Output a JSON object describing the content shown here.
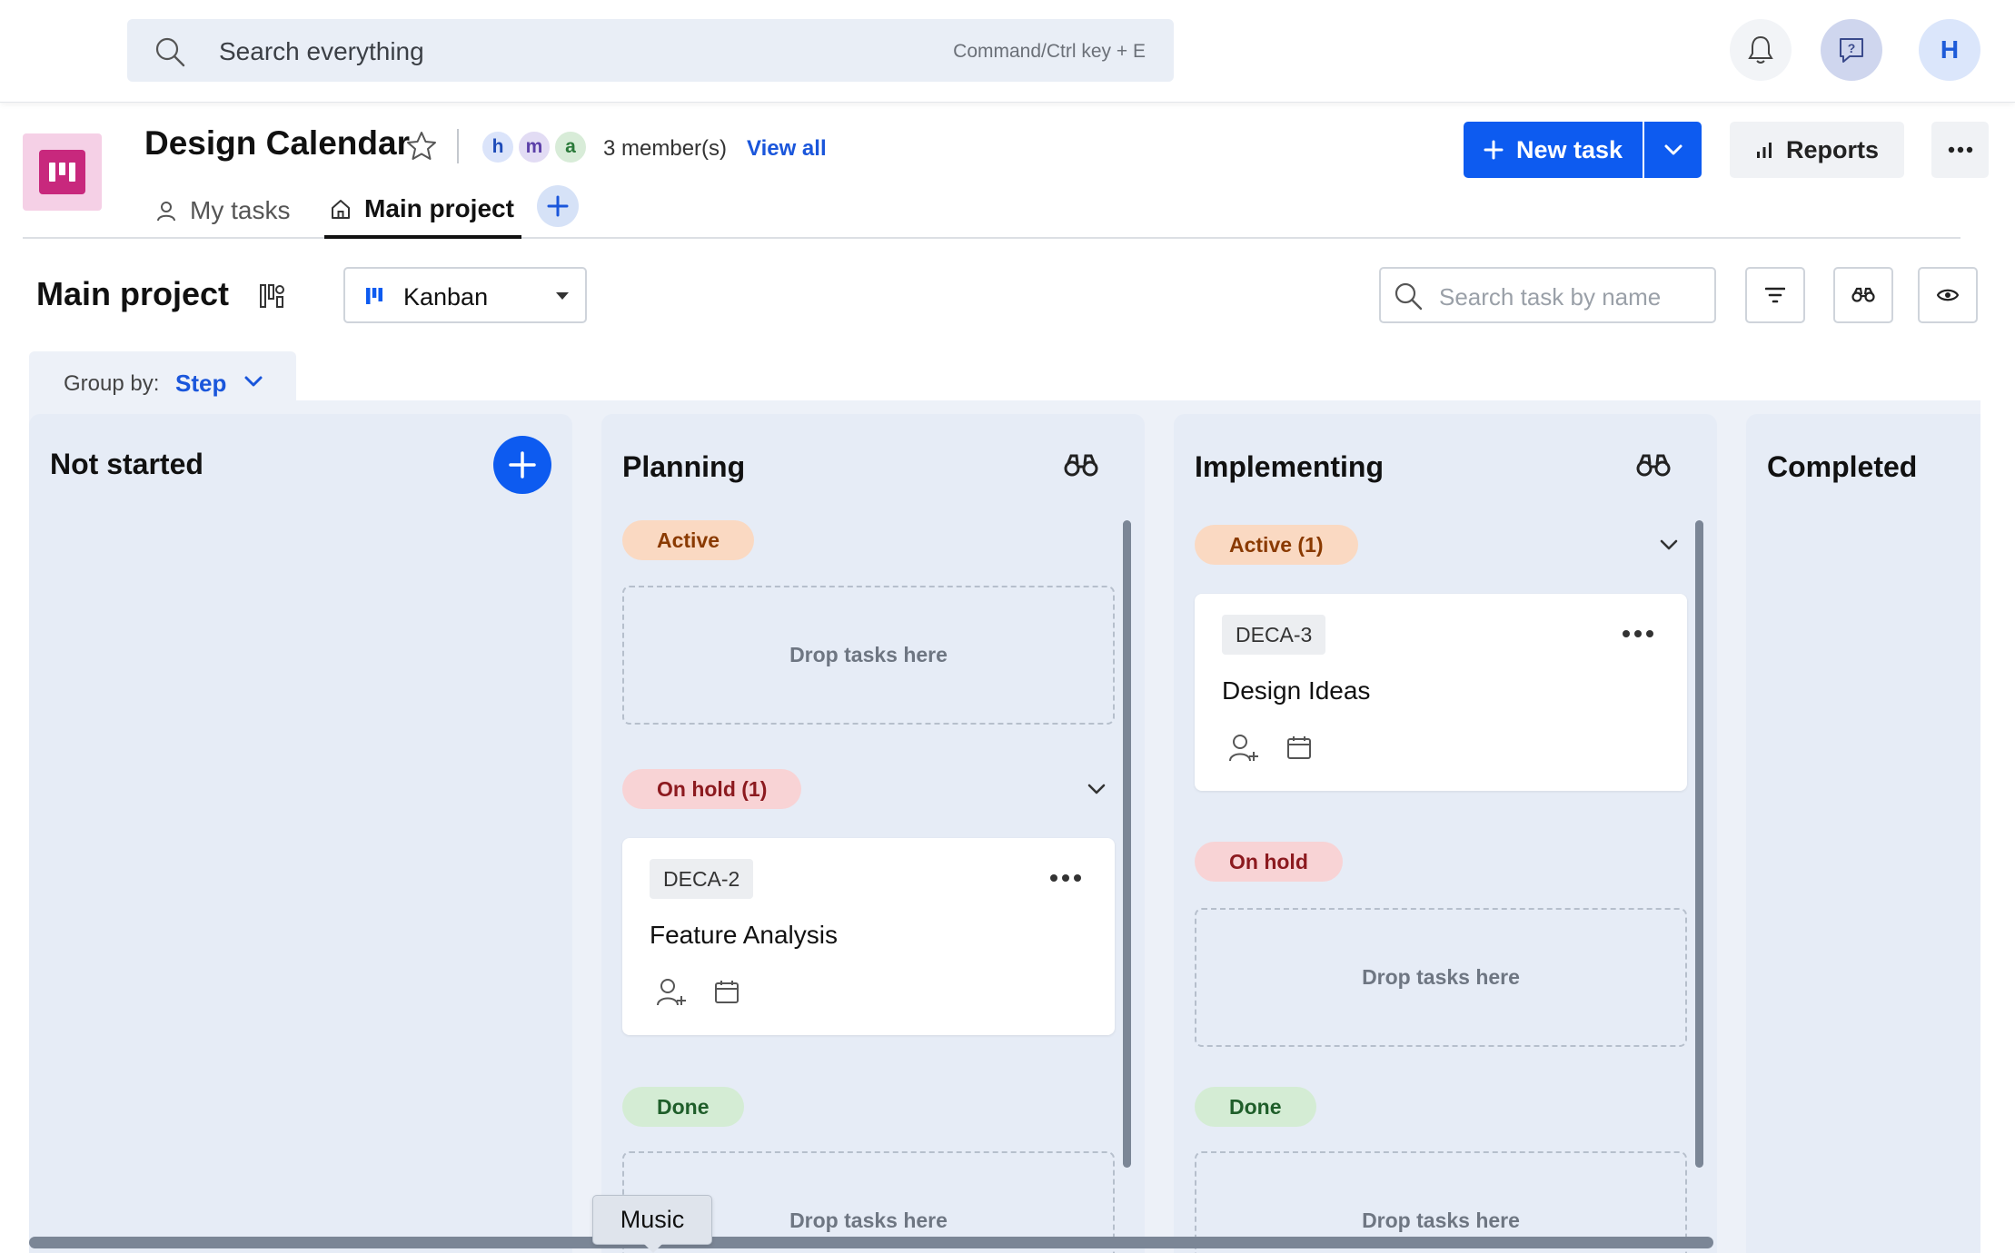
{
  "topbar": {
    "search_placeholder": "Search everything",
    "search_shortcut": "Command/Ctrl key + E",
    "avatar_initial": "H"
  },
  "project": {
    "title": "Design Calendar",
    "members": [
      "h",
      "m",
      "a"
    ],
    "members_count": "3 member(s)",
    "view_all": "View all",
    "new_task_label": "New task",
    "reports_label": "Reports"
  },
  "tabs": [
    {
      "label": "My tasks",
      "active": false
    },
    {
      "label": "Main project",
      "active": true
    }
  ],
  "toolbar": {
    "view_title": "Main project",
    "view_mode": "Kanban",
    "task_search_placeholder": "Search task by name"
  },
  "group_by": {
    "label": "Group by:",
    "value": "Step"
  },
  "columns": [
    {
      "title": "Not started"
    },
    {
      "title": "Planning",
      "sections": [
        {
          "label": "Active",
          "drop_text": "Drop tasks here"
        },
        {
          "label": "On hold (1)",
          "cards": [
            {
              "key": "DECA-2",
              "name": "Feature Analysis"
            }
          ]
        },
        {
          "label": "Done",
          "drop_text": "Drop tasks here"
        }
      ]
    },
    {
      "title": "Implementing",
      "sections": [
        {
          "label": "Active (1)",
          "cards": [
            {
              "key": "DECA-3",
              "name": "Design Ideas"
            }
          ]
        },
        {
          "label": "On hold",
          "drop_text": "Drop tasks here"
        },
        {
          "label": "Done",
          "drop_text": "Drop tasks here"
        }
      ]
    },
    {
      "title": "Completed"
    }
  ],
  "tooltip": "Music",
  "colors": {
    "primary": "#0d5bf0",
    "brand_pink": "#c8287d",
    "link": "#1a56db",
    "board_bg": "#edf1f8"
  }
}
